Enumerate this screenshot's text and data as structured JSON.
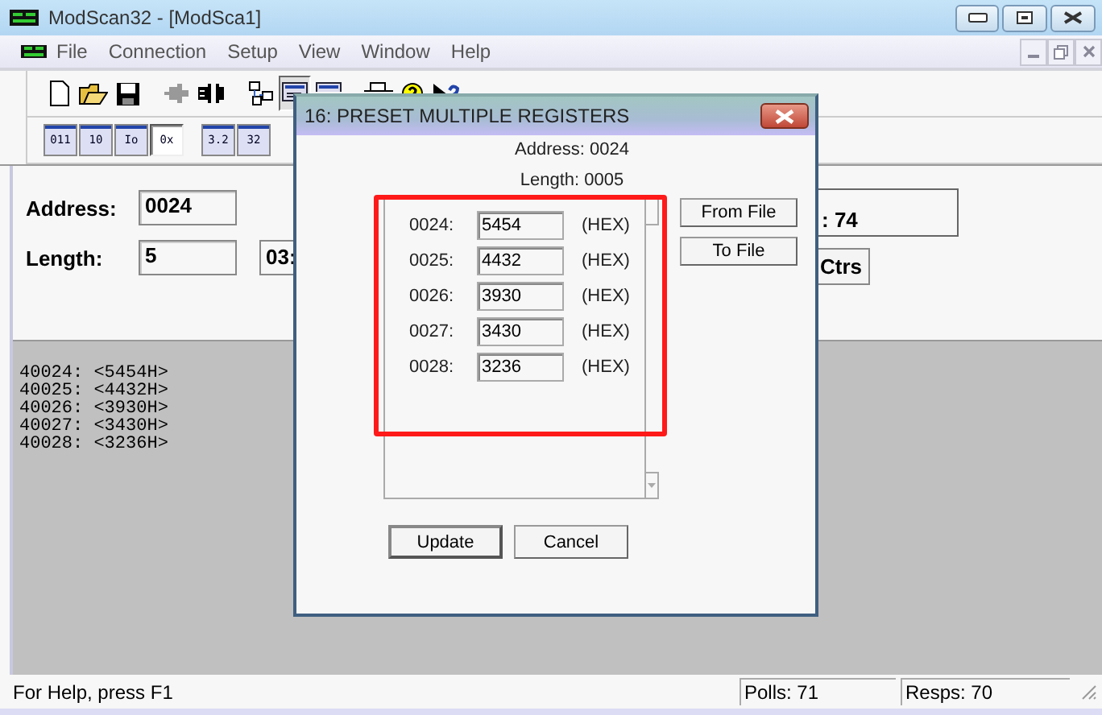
{
  "window": {
    "title": "ModScan32 - [ModSca1]"
  },
  "menu": [
    "File",
    "Connection",
    "Setup",
    "View",
    "Window",
    "Help"
  ],
  "toolbar": [
    {
      "kind": "new",
      "pressed": false
    },
    {
      "kind": "open",
      "pressed": false
    },
    {
      "kind": "save",
      "pressed": false
    },
    {
      "kind": "connect",
      "pressed": false
    },
    {
      "kind": "disconnect",
      "pressed": false
    },
    {
      "kind": "tree",
      "pressed": false
    },
    {
      "kind": "display",
      "pressed": true
    },
    {
      "kind": "display",
      "pressed": false
    },
    {
      "kind": "print",
      "pressed": false
    },
    {
      "kind": "about",
      "pressed": false
    },
    {
      "kind": "help",
      "pressed": false
    }
  ],
  "format_toolbar": [
    {
      "label": "011",
      "selected": false
    },
    {
      "label": "10",
      "selected": false
    },
    {
      "label": "Io",
      "selected": false
    },
    {
      "label": "0x",
      "selected": true
    },
    {
      "label": "3.2",
      "selected": false
    },
    {
      "label": "32",
      "selected": false
    }
  ],
  "form": {
    "address_label": "Address:",
    "address": "0024",
    "length_label": "Length:",
    "length": "5",
    "device_type": "03:",
    "counter": ": 74",
    "reset_button": "Ctrs"
  },
  "data_lines": [
    "40024: <5454H>",
    "40025: <4432H>",
    "40026: <3930H>",
    "40027: <3430H>",
    "40028: <3236H>"
  ],
  "dialog": {
    "title": "16: PRESET MULTIPLE REGISTERS",
    "address": "Address: 0024",
    "length": "Length: 0005",
    "registers": [
      {
        "address": "0024:",
        "value": "5454",
        "format": "(HEX)"
      },
      {
        "address": "0025:",
        "value": "4432",
        "format": "(HEX)"
      },
      {
        "address": "0026:",
        "value": "3930",
        "format": "(HEX)"
      },
      {
        "address": "0027:",
        "value": "3430",
        "format": "(HEX)"
      },
      {
        "address": "0028:",
        "value": "3236",
        "format": "(HEX)"
      }
    ],
    "from_file": "From File",
    "to_file": "To File",
    "update": "Update",
    "cancel": "Cancel"
  },
  "status_bar": {
    "help": "For Help, press F1",
    "polls": "Polls: 71",
    "resps": "Resps: 70"
  }
}
